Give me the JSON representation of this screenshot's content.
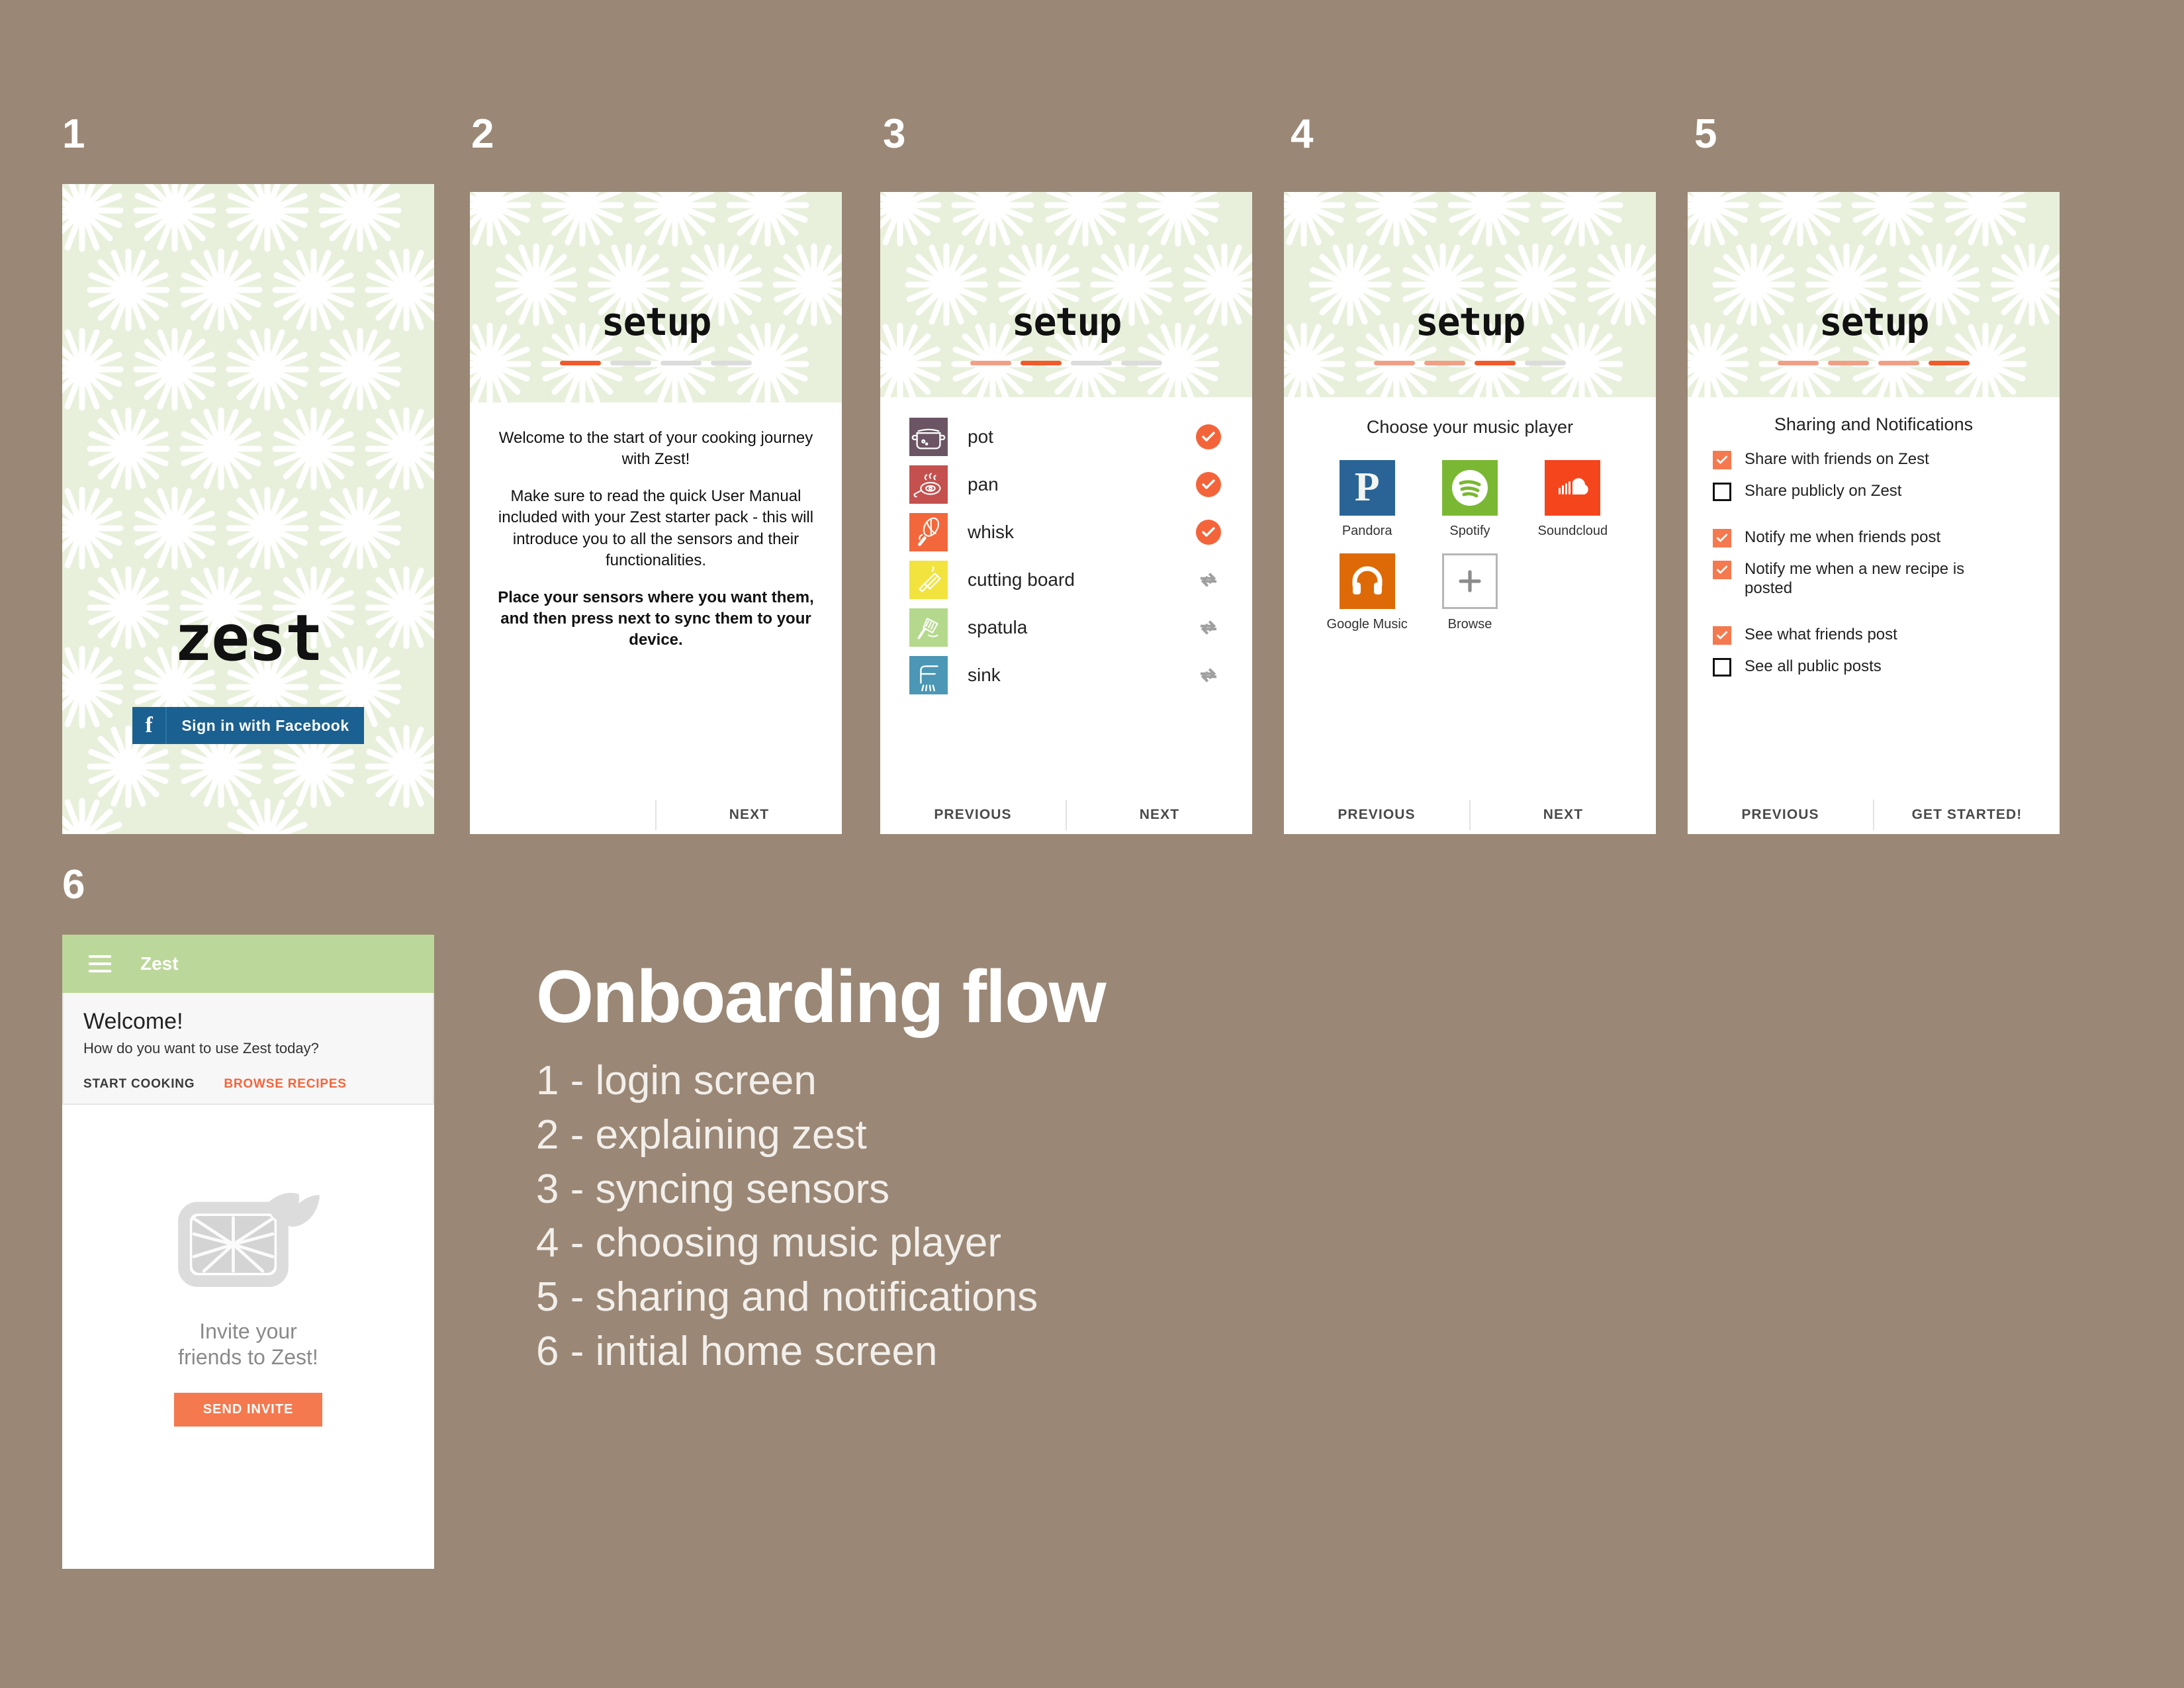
{
  "colors": {
    "background": "#9a8775",
    "pattern_green": "#e8f0dc",
    "accent_orange": "#f4643a",
    "accent_orange_light": "#f0a086",
    "appbar_green": "#bcd79a",
    "facebook_blue": "#1a6090",
    "lemon_yellow": "#f5d12e",
    "lemon_flesh": "#f2ef7a",
    "leaf_dark": "#1f7a33",
    "leaf_light": "#3cb43c"
  },
  "steps": [
    {
      "number": "1"
    },
    {
      "number": "2"
    },
    {
      "number": "3"
    },
    {
      "number": "4"
    },
    {
      "number": "5"
    },
    {
      "number": "6"
    }
  ],
  "screen1": {
    "wordmark": "zest",
    "facebook_button": "Sign in with Facebook",
    "facebook_glyph": "f"
  },
  "screen2": {
    "title": "setup",
    "progress": {
      "total": 4,
      "current": 1
    },
    "paragraphs": [
      {
        "text": "Welcome to the start of your cooking journey with Zest!",
        "bold": false
      },
      {
        "text": "Make sure to read the quick User Manual included with your Zest starter pack - this will introduce you to all the sensors and their functionalities.",
        "bold": false
      },
      {
        "text": "Place your sensors where you want them, and then press next to sync them to your device.",
        "bold": true
      }
    ],
    "nav": {
      "previous": "",
      "next": "NEXT"
    }
  },
  "screen3": {
    "title": "setup",
    "progress": {
      "total": 4,
      "current": 2
    },
    "sensors": [
      {
        "label": "pot",
        "icon": "pot-icon",
        "color": "#6b5463",
        "state": "synced"
      },
      {
        "label": "pan",
        "icon": "pan-icon",
        "color": "#c4514e",
        "state": "synced"
      },
      {
        "label": "whisk",
        "icon": "whisk-icon",
        "color": "#f2683c",
        "state": "synced"
      },
      {
        "label": "cutting board",
        "icon": "cutting-board-icon",
        "color": "#f2e33e",
        "state": "syncing"
      },
      {
        "label": "spatula",
        "icon": "spatula-icon",
        "color": "#b4d98c",
        "state": "syncing"
      },
      {
        "label": "sink",
        "icon": "sink-icon",
        "color": "#4b97b5",
        "state": "syncing"
      }
    ],
    "nav": {
      "previous": "PREVIOUS",
      "next": "NEXT"
    }
  },
  "screen4": {
    "title": "setup",
    "progress": {
      "total": 4,
      "current": 3
    },
    "heading": "Choose your music player",
    "players": [
      {
        "name": "Pandora",
        "icon": "pandora-icon",
        "color": "#2a6496"
      },
      {
        "name": "Spotify",
        "icon": "spotify-icon",
        "color": "#7ab833"
      },
      {
        "name": "Soundcloud",
        "icon": "soundcloud-icon",
        "color": "#f5451d"
      },
      {
        "name": "Google Music",
        "icon": "google-music-icon",
        "color": "#dd6a06"
      },
      {
        "name": "Browse",
        "icon": "plus-icon",
        "color": "#ffffff"
      }
    ],
    "nav": {
      "previous": "PREVIOUS",
      "next": "NEXT"
    }
  },
  "screen5": {
    "title": "setup",
    "progress": {
      "total": 4,
      "current": 4
    },
    "heading": "Sharing and Notifications",
    "options": [
      {
        "label": "Share with friends on Zest",
        "checked": true
      },
      {
        "label": "Share publicly on Zest",
        "checked": false
      },
      {
        "label": "Notify me when friends post",
        "checked": true
      },
      {
        "label": "Notify me when a new recipe is posted",
        "checked": true
      },
      {
        "label": "See what friends post",
        "checked": true
      },
      {
        "label": "See all public posts",
        "checked": false
      }
    ],
    "nav": {
      "previous": "PREVIOUS",
      "next": "GET STARTED!"
    }
  },
  "screen6": {
    "appbar_title": "Zest",
    "menu_icon": "hamburger-icon",
    "welcome_heading": "Welcome!",
    "welcome_sub": "How do you want to use Zest today?",
    "action_primary": "START COOKING",
    "action_secondary": "BROWSE RECIPES",
    "invite_line1": "Invite your",
    "invite_line2": "friends to Zest!",
    "invite_button": "SEND INVITE"
  },
  "caption": {
    "title": "Onboarding flow",
    "items": [
      "1 - login screen",
      "2 - explaining zest",
      "3 - syncing sensors",
      "4 - choosing music player",
      "5 - sharing and notifications",
      "6 - initial home screen"
    ]
  }
}
